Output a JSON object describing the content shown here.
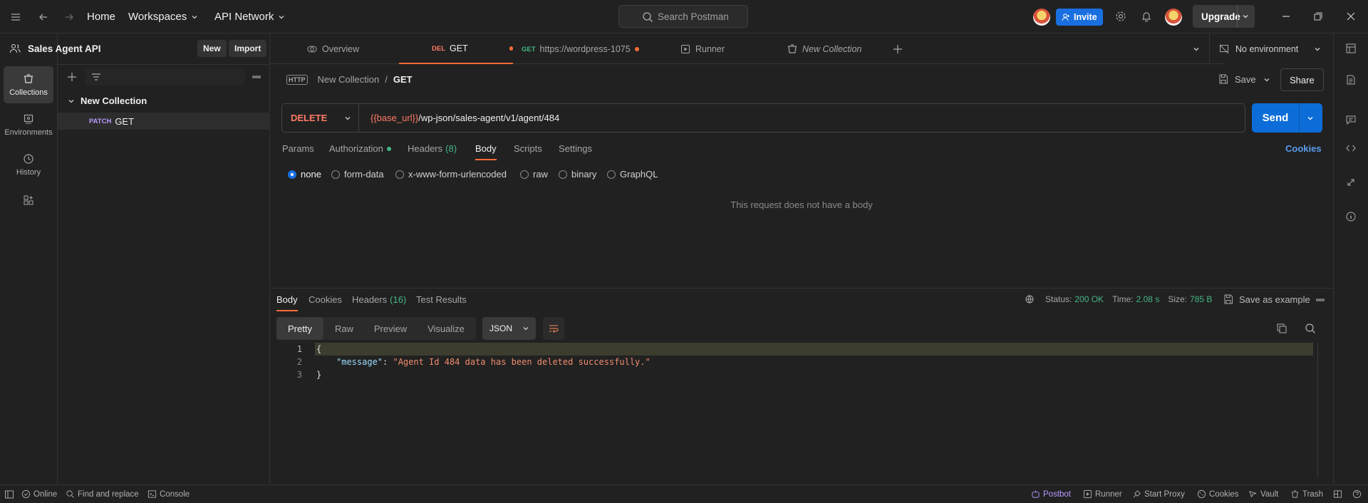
{
  "topbar": {
    "home": "Home",
    "workspaces": "Workspaces",
    "api_network": "API Network",
    "search_placeholder": "Search Postman",
    "invite": "Invite",
    "upgrade": "Upgrade"
  },
  "rail": {
    "items": [
      {
        "label": "Collections"
      },
      {
        "label": "Environments"
      },
      {
        "label": "History"
      }
    ]
  },
  "sidebar": {
    "workspace_name": "Sales Agent API",
    "new_label": "New",
    "import_label": "Import",
    "collection_name": "New Collection",
    "request_method": "PATCH",
    "request_name": "GET"
  },
  "tabs": [
    {
      "label": "Overview"
    },
    {
      "method": "DEL",
      "label": "GET"
    },
    {
      "method": "GET",
      "label": "https://wordpress-1075"
    },
    {
      "label": "Runner"
    },
    {
      "label": "New Collection"
    }
  ],
  "environment": "No environment",
  "breadcrumb": {
    "parent": "New Collection",
    "separator": "/",
    "current": "GET"
  },
  "actions": {
    "save": "Save",
    "share": "Share"
  },
  "request": {
    "method": "DELETE",
    "url_var": "{{base_url}}",
    "url_path": "/wp-json/sales-agent/v1/agent/484",
    "send": "Send"
  },
  "request_tabs": {
    "params": "Params",
    "authorization": "Authorization",
    "headers": "Headers",
    "headers_count": "(8)",
    "body": "Body",
    "scripts": "Scripts",
    "settings": "Settings",
    "cookies": "Cookies"
  },
  "body_types": [
    "none",
    "form-data",
    "x-www-form-urlencoded",
    "raw",
    "binary",
    "GraphQL"
  ],
  "no_body_message": "This request does not have a body",
  "response": {
    "tabs": {
      "body": "Body",
      "cookies": "Cookies",
      "headers": "Headers",
      "headers_count": "(16)",
      "tests": "Test Results"
    },
    "status_label": "Status:",
    "status_value": "200 OK",
    "time_label": "Time:",
    "time_value": "2.08 s",
    "size_label": "Size:",
    "size_value": "785 B",
    "save_example": "Save as example",
    "views": [
      "Pretty",
      "Raw",
      "Preview",
      "Visualize"
    ],
    "format": "JSON",
    "lines": [
      {
        "num": "1",
        "text": "{"
      },
      {
        "num": "2",
        "key": "\"message\"",
        "colon": ": ",
        "value": "\"Agent Id 484 data has been deleted successfully.\""
      },
      {
        "num": "3",
        "text": "}"
      }
    ]
  },
  "statusbar": {
    "online": "Online",
    "find_replace": "Find and replace",
    "console": "Console",
    "postbot": "Postbot",
    "runner": "Runner",
    "start_proxy": "Start Proxy",
    "cookies": "Cookies",
    "vault": "Vault",
    "trash": "Trash"
  },
  "colors": {
    "accent": "#ff6c37",
    "primary_blue": "#0c6dd9",
    "status_ok": "#43b783",
    "url_var": "#ff7a64"
  }
}
